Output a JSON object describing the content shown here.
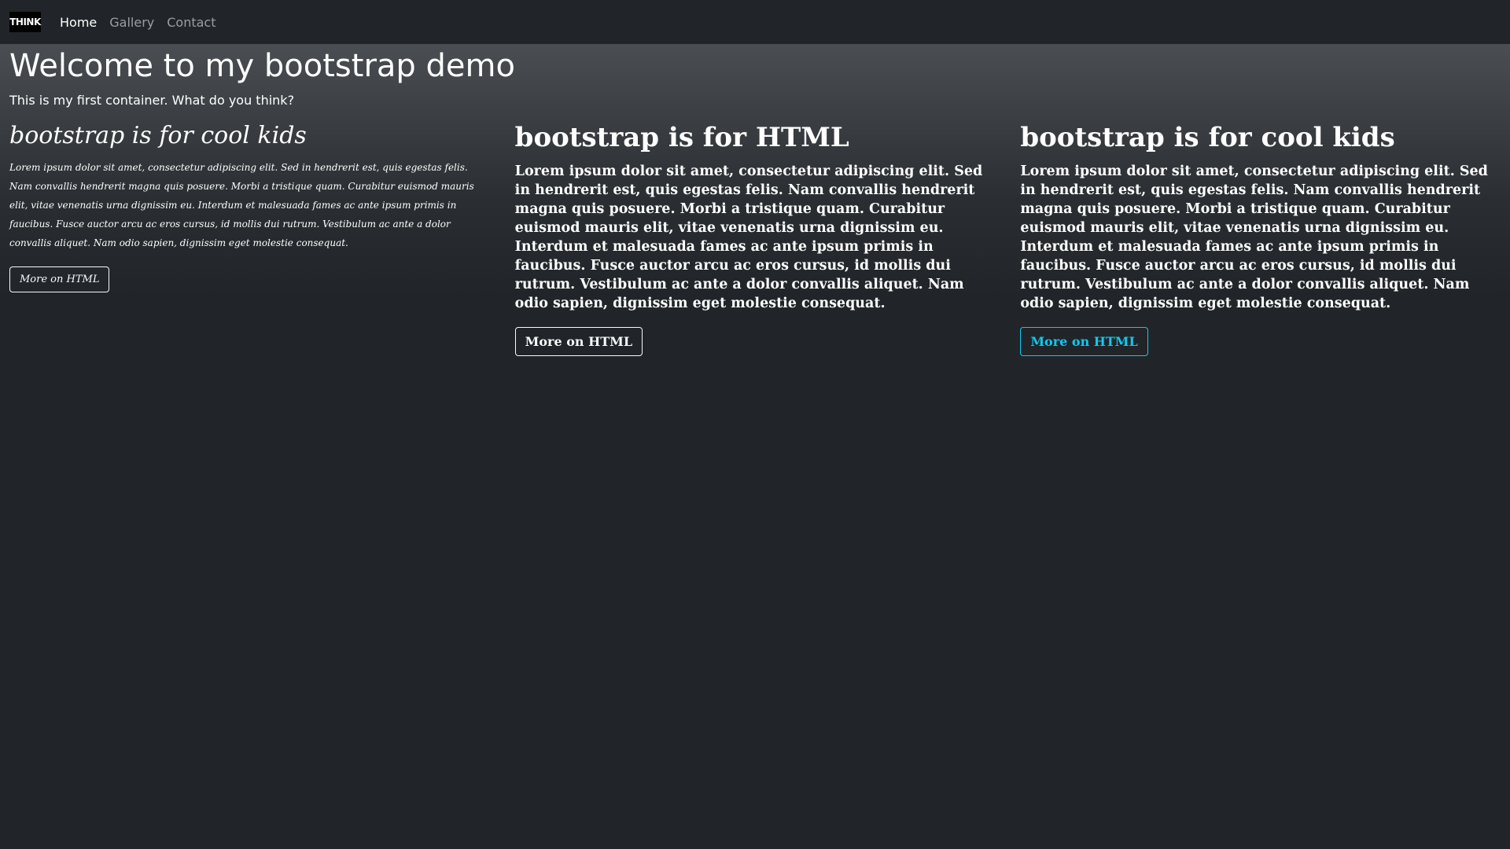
{
  "nav": {
    "brand": "THINK",
    "links": [
      "Home",
      "Gallery",
      "Contact"
    ]
  },
  "hero": {
    "title": "Welcome to my bootstrap demo",
    "lead": "This is my first container. What do you think?"
  },
  "columns": [
    {
      "heading": "bootstrap is for cool kids",
      "body": "Lorem ipsum dolor sit amet, consectetur adipiscing elit. Sed in hendrerit est, quis egestas felis. Nam convallis hendrerit magna quis posuere. Morbi a tristique quam. Curabitur euismod mauris elit, vitae venenatis urna dignissim eu. Interdum et malesuada fames ac ante ipsum primis in faucibus. Fusce auctor arcu ac eros cursus, id mollis dui rutrum. Vestibulum ac ante a dolor convallis aliquet. Nam odio sapien, dignissim eget molestie consequat.",
      "button": "More on HTML"
    },
    {
      "heading": "bootstrap is for HTML",
      "body": "Lorem ipsum dolor sit amet, consectetur adipiscing elit. Sed in hendrerit est, quis egestas felis. Nam convallis hendrerit magna quis posuere. Morbi a tristique quam. Curabitur euismod mauris elit, vitae venenatis urna dignissim eu. Interdum et malesuada fames ac ante ipsum primis in faucibus. Fusce auctor arcu ac eros cursus, id mollis dui rutrum. Vestibulum ac ante a dolor convallis aliquet. Nam odio sapien, dignissim eget molestie consequat.",
      "button": "More on HTML"
    },
    {
      "heading": "bootstrap is for cool kids",
      "body": "Lorem ipsum dolor sit amet, consectetur adipiscing elit. Sed in hendrerit est, quis egestas felis. Nam convallis hendrerit magna quis posuere. Morbi a tristique quam. Curabitur euismod mauris elit, vitae venenatis urna dignissim eu. Interdum et malesuada fames ac ante ipsum primis in faucibus. Fusce auctor arcu ac eros cursus, id mollis dui rutrum. Vestibulum ac ante a dolor convallis aliquet. Nam odio sapien, dignissim eget molestie consequat.",
      "button": "More on HTML"
    }
  ],
  "colors": {
    "background": "#212529",
    "button_light": "#f8f9fa",
    "button_info": "#0dcaf0"
  }
}
